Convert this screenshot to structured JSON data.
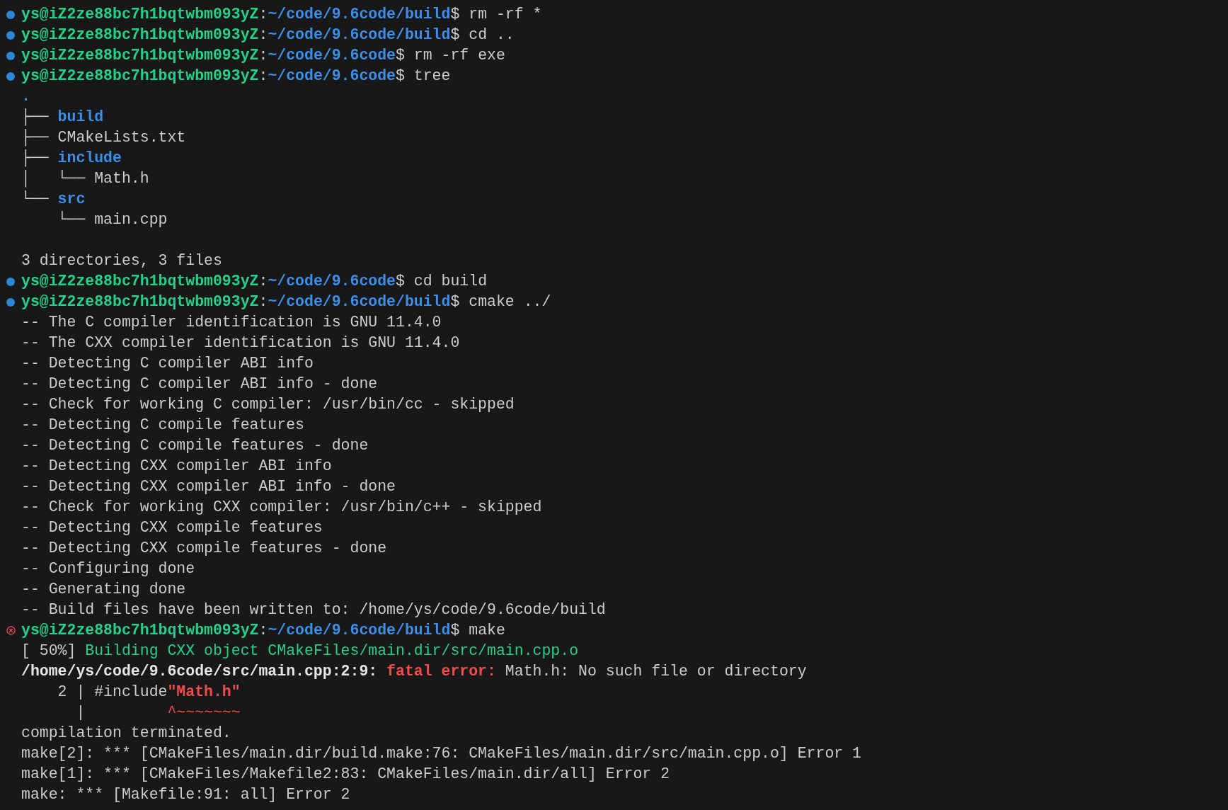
{
  "lines": [
    {
      "kind": "prompt",
      "failed": false,
      "segments": [
        {
          "kind": "user",
          "text": "ys@iZ2ze88bc7h1bqtwbm093yZ"
        },
        {
          "kind": "plain",
          "text": ":"
        },
        {
          "kind": "path",
          "text": "~/code/9.6code/build"
        },
        {
          "kind": "plain",
          "text": "$ rm -rf *"
        }
      ]
    },
    {
      "kind": "prompt",
      "failed": false,
      "segments": [
        {
          "kind": "user",
          "text": "ys@iZ2ze88bc7h1bqtwbm093yZ"
        },
        {
          "kind": "plain",
          "text": ":"
        },
        {
          "kind": "path",
          "text": "~/code/9.6code/build"
        },
        {
          "kind": "plain",
          "text": "$ cd .."
        }
      ]
    },
    {
      "kind": "prompt",
      "failed": false,
      "segments": [
        {
          "kind": "user",
          "text": "ys@iZ2ze88bc7h1bqtwbm093yZ"
        },
        {
          "kind": "plain",
          "text": ":"
        },
        {
          "kind": "path",
          "text": "~/code/9.6code"
        },
        {
          "kind": "plain",
          "text": "$ rm -rf exe"
        }
      ]
    },
    {
      "kind": "prompt",
      "failed": false,
      "segments": [
        {
          "kind": "user",
          "text": "ys@iZ2ze88bc7h1bqtwbm093yZ"
        },
        {
          "kind": "plain",
          "text": ":"
        },
        {
          "kind": "path",
          "text": "~/code/9.6code"
        },
        {
          "kind": "plain",
          "text": "$ tree"
        }
      ]
    },
    {
      "kind": "output",
      "segments": [
        {
          "kind": "dir",
          "text": "."
        }
      ]
    },
    {
      "kind": "output",
      "segments": [
        {
          "kind": "plain",
          "text": "├── "
        },
        {
          "kind": "dir",
          "text": "build"
        }
      ]
    },
    {
      "kind": "output",
      "segments": [
        {
          "kind": "plain",
          "text": "├── CMakeLists.txt"
        }
      ]
    },
    {
      "kind": "output",
      "segments": [
        {
          "kind": "plain",
          "text": "├── "
        },
        {
          "kind": "dir",
          "text": "include"
        }
      ]
    },
    {
      "kind": "output",
      "segments": [
        {
          "kind": "plain",
          "text": "│   └── Math.h"
        }
      ]
    },
    {
      "kind": "output",
      "segments": [
        {
          "kind": "plain",
          "text": "└── "
        },
        {
          "kind": "dir",
          "text": "src"
        }
      ]
    },
    {
      "kind": "output",
      "segments": [
        {
          "kind": "plain",
          "text": "    └── main.cpp"
        }
      ]
    },
    {
      "kind": "blank"
    },
    {
      "kind": "output",
      "segments": [
        {
          "kind": "plain",
          "text": "3 directories, 3 files"
        }
      ]
    },
    {
      "kind": "prompt",
      "failed": false,
      "segments": [
        {
          "kind": "user",
          "text": "ys@iZ2ze88bc7h1bqtwbm093yZ"
        },
        {
          "kind": "plain",
          "text": ":"
        },
        {
          "kind": "path",
          "text": "~/code/9.6code"
        },
        {
          "kind": "plain",
          "text": "$ cd build"
        }
      ]
    },
    {
      "kind": "prompt",
      "failed": false,
      "segments": [
        {
          "kind": "user",
          "text": "ys@iZ2ze88bc7h1bqtwbm093yZ"
        },
        {
          "kind": "plain",
          "text": ":"
        },
        {
          "kind": "path",
          "text": "~/code/9.6code/build"
        },
        {
          "kind": "plain",
          "text": "$ cmake ../"
        }
      ]
    },
    {
      "kind": "output",
      "segments": [
        {
          "kind": "plain",
          "text": "-- The C compiler identification is GNU 11.4.0"
        }
      ]
    },
    {
      "kind": "output",
      "segments": [
        {
          "kind": "plain",
          "text": "-- The CXX compiler identification is GNU 11.4.0"
        }
      ]
    },
    {
      "kind": "output",
      "segments": [
        {
          "kind": "plain",
          "text": "-- Detecting C compiler ABI info"
        }
      ]
    },
    {
      "kind": "output",
      "segments": [
        {
          "kind": "plain",
          "text": "-- Detecting C compiler ABI info - done"
        }
      ]
    },
    {
      "kind": "output",
      "segments": [
        {
          "kind": "plain",
          "text": "-- Check for working C compiler: /usr/bin/cc - skipped"
        }
      ]
    },
    {
      "kind": "output",
      "segments": [
        {
          "kind": "plain",
          "text": "-- Detecting C compile features"
        }
      ]
    },
    {
      "kind": "output",
      "segments": [
        {
          "kind": "plain",
          "text": "-- Detecting C compile features - done"
        }
      ]
    },
    {
      "kind": "output",
      "segments": [
        {
          "kind": "plain",
          "text": "-- Detecting CXX compiler ABI info"
        }
      ]
    },
    {
      "kind": "output",
      "segments": [
        {
          "kind": "plain",
          "text": "-- Detecting CXX compiler ABI info - done"
        }
      ]
    },
    {
      "kind": "output",
      "segments": [
        {
          "kind": "plain",
          "text": "-- Check for working CXX compiler: /usr/bin/c++ - skipped"
        }
      ]
    },
    {
      "kind": "output",
      "segments": [
        {
          "kind": "plain",
          "text": "-- Detecting CXX compile features"
        }
      ]
    },
    {
      "kind": "output",
      "segments": [
        {
          "kind": "plain",
          "text": "-- Detecting CXX compile features - done"
        }
      ]
    },
    {
      "kind": "output",
      "segments": [
        {
          "kind": "plain",
          "text": "-- Configuring done"
        }
      ]
    },
    {
      "kind": "output",
      "segments": [
        {
          "kind": "plain",
          "text": "-- Generating done"
        }
      ]
    },
    {
      "kind": "output",
      "segments": [
        {
          "kind": "plain",
          "text": "-- Build files have been written to: /home/ys/code/9.6code/build"
        }
      ]
    },
    {
      "kind": "prompt",
      "failed": true,
      "segments": [
        {
          "kind": "user",
          "text": "ys@iZ2ze88bc7h1bqtwbm093yZ"
        },
        {
          "kind": "plain",
          "text": ":"
        },
        {
          "kind": "path",
          "text": "~/code/9.6code/build"
        },
        {
          "kind": "plain",
          "text": "$ make"
        }
      ]
    },
    {
      "kind": "output",
      "segments": [
        {
          "kind": "plain",
          "text": "[ 50%] "
        },
        {
          "kind": "progress",
          "text": "Building CXX object CMakeFiles/main.dir/src/main.cpp.o"
        }
      ]
    },
    {
      "kind": "output",
      "segments": [
        {
          "kind": "bold",
          "text": "/home/ys/code/9.6code/src/main.cpp:2:9: "
        },
        {
          "kind": "error",
          "text": "fatal error: "
        },
        {
          "kind": "plain",
          "text": "Math.h: No such file or directory"
        }
      ]
    },
    {
      "kind": "output",
      "segments": [
        {
          "kind": "plain",
          "text": "    2 | #include"
        },
        {
          "kind": "error",
          "text": "\"Math.h\""
        }
      ]
    },
    {
      "kind": "output",
      "segments": [
        {
          "kind": "plain",
          "text": "      |         "
        },
        {
          "kind": "caret",
          "text": "^~~~~~~~"
        }
      ]
    },
    {
      "kind": "output",
      "segments": [
        {
          "kind": "plain",
          "text": "compilation terminated."
        }
      ]
    },
    {
      "kind": "output",
      "segments": [
        {
          "kind": "plain",
          "text": "make[2]: *** [CMakeFiles/main.dir/build.make:76: CMakeFiles/main.dir/src/main.cpp.o] Error 1"
        }
      ]
    },
    {
      "kind": "output",
      "segments": [
        {
          "kind": "plain",
          "text": "make[1]: *** [CMakeFiles/Makefile2:83: CMakeFiles/main.dir/all] Error 2"
        }
      ]
    },
    {
      "kind": "output",
      "segments": [
        {
          "kind": "plain",
          "text": "make: *** [Makefile:91: all] Error 2"
        }
      ]
    }
  ]
}
